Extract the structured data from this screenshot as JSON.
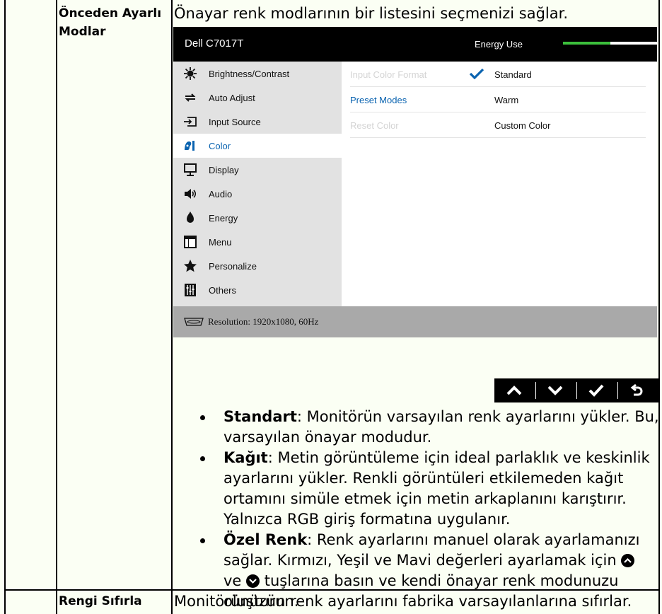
{
  "rows": [
    {
      "label_lines": [
        "Önceden Ayarlı",
        "Modlar"
      ],
      "description": "Önayar renk modlarının bir listesini seçmenizi sağlar."
    },
    {
      "label_lines": [
        "Rengi Sıfırla"
      ],
      "description": "Monitörünüzün renk ayarlarını fabrika varsayılanlarına sıfırlar."
    }
  ],
  "osd": {
    "model": "Dell C7017T",
    "energy_label": "Energy Use",
    "energy_level": 0.5,
    "menu_items": [
      {
        "label": "Brightness/Contrast",
        "icon": "brightness-icon",
        "active": false
      },
      {
        "label": "Auto Adjust",
        "icon": "auto-adjust-icon",
        "active": false
      },
      {
        "label": "Input Source",
        "icon": "input-source-icon",
        "active": false
      },
      {
        "label": "Color",
        "icon": "color-palette-icon",
        "active": true
      },
      {
        "label": "Display",
        "icon": "display-icon",
        "active": false
      },
      {
        "label": "Audio",
        "icon": "speaker-icon",
        "active": false
      },
      {
        "label": "Energy",
        "icon": "flame-icon",
        "active": false
      },
      {
        "label": "Menu",
        "icon": "menu-window-icon",
        "active": false
      },
      {
        "label": "Personalize",
        "icon": "star-icon",
        "active": false
      },
      {
        "label": "Others",
        "icon": "sliders-icon",
        "active": false
      }
    ],
    "options": [
      {
        "label": "Input Color Format",
        "value": "Standard",
        "checked": true,
        "active": false
      },
      {
        "label": "Preset Modes",
        "value": "Warm",
        "checked": false,
        "active": true
      },
      {
        "label": "Reset Color",
        "value": "Custom Color",
        "checked": false,
        "active": false
      }
    ],
    "footer": "Resolution: 1920x1080, 60Hz",
    "accent_color": "#0a63b0",
    "energy_color": "#3cbf3c"
  },
  "nav_buttons": [
    {
      "icon": "chevron-up-icon"
    },
    {
      "icon": "chevron-down-icon"
    },
    {
      "icon": "checkmark-icon"
    },
    {
      "icon": "back-icon"
    }
  ],
  "bullets": [
    {
      "term": "Standart",
      "lines": [
        ": Monitörün varsayılan renk ayarlarını yükler. Bu,",
        "varsayılan önayar modudur."
      ]
    },
    {
      "term": "Kağıt",
      "lines": [
        ": Metin görüntüleme için ideal parlaklık ve keskinlik",
        "ayarlarını yükler. Renkli görüntüleri etkilemeden kağıt",
        "ortamını simüle etmek için metin arkaplanını karıştırır.",
        "Yalnızca RGB giriş formatına uygulanır."
      ]
    },
    {
      "term": "Özel Renk",
      "line1": ": Renk ayarlarını manuel olarak ayarlamanızı",
      "line2_a": "sağlar. Kırmızı, Yeşil ve Mavi değerleri ayarlamak için",
      "line3_a": "ve",
      "line3_b": "tuşlarına basın ve kendi önayar renk modunuzu",
      "line4": "oluşturun."
    }
  ]
}
